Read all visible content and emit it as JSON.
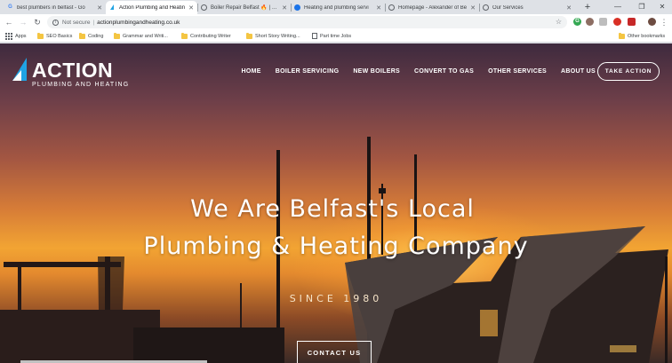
{
  "browser": {
    "tabs": [
      {
        "title": "best plumbers in belfast - Go",
        "favicon": "G",
        "favicon_color": "#4285f4",
        "active": false
      },
      {
        "title": "Action Plumbing and Heatin",
        "favicon": "",
        "favicon_color": "#1fa3e3",
        "active": true
      },
      {
        "title": "Boiler Repair Belfast 🔥 | Hea",
        "favicon": "",
        "favicon_color": "#5f6368",
        "active": false
      },
      {
        "title": "Heating and plumbing servi",
        "favicon": "",
        "favicon_color": "#1a73e8",
        "active": false
      },
      {
        "title": "Homepage - Alexander of Be",
        "favicon": "",
        "favicon_color": "#5f6368",
        "active": false
      },
      {
        "title": "Our Services",
        "favicon": "",
        "favicon_color": "#5f6368",
        "active": false
      }
    ],
    "new_tab_symbol": "+",
    "window_controls": {
      "minimize": "—",
      "restore": "❐",
      "close": "✕"
    },
    "address_bar": {
      "security_text": "Not secure",
      "separator": "|",
      "url": "actionplumbingandheating.co.uk"
    },
    "bookmarks": [
      {
        "label": "Apps",
        "icon": "apps-grid-icon"
      },
      {
        "label": "SEO Basics",
        "icon": "folder-icon"
      },
      {
        "label": "Coding",
        "icon": "folder-icon"
      },
      {
        "label": "Grammar and Writi...",
        "icon": "folder-icon"
      },
      {
        "label": "Contributing Writer",
        "icon": "folder-icon"
      },
      {
        "label": "Short Story Writing...",
        "icon": "folder-icon"
      },
      {
        "label": "Part time Jobs",
        "icon": "page-icon"
      }
    ],
    "other_bookmarks": "Other bookmarks"
  },
  "site": {
    "logo": {
      "big": "ACTION",
      "small": "PLUMBING AND HEATING",
      "accent": "#1fa3e3"
    },
    "nav": [
      "HOME",
      "BOILER SERVICING",
      "NEW BOILERS",
      "CONVERT TO GAS",
      "OTHER SERVICES",
      "ABOUT US"
    ],
    "cta": "TAKE ACTION",
    "headline_line1": "We Are Belfast's Local",
    "headline_line2": "Plumbing & Heating Company",
    "since": "SINCE 1980",
    "contact_button": "CONTACT US"
  }
}
